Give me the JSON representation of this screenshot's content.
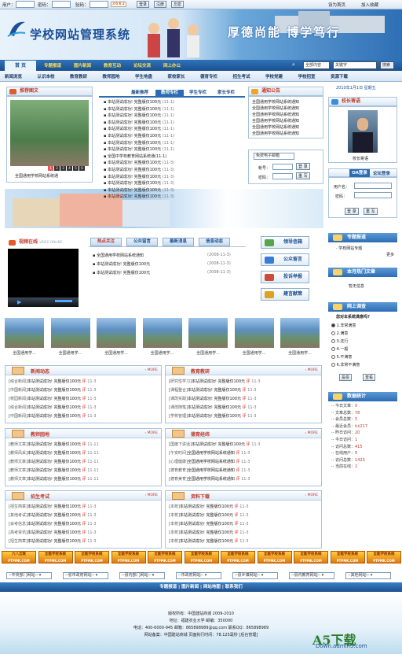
{
  "topbar": {
    "user_label": "用户：",
    "pass_label": "密码：",
    "code_label": "验码：",
    "code_val": "3 6 6 2",
    "login": "登录",
    "register": "注册",
    "forgot": "忘密",
    "homepage": "设为首页",
    "favorite": "加入收藏"
  },
  "header": {
    "site_title": "学校网站管理系统",
    "slogan": "厚德尚能  博学笃行"
  },
  "nav": {
    "home": "首 页",
    "items": [
      "专题报道",
      "图片新闻",
      "教育互动",
      "论坛交流",
      "网上办公"
    ],
    "search_scope": "全部内容",
    "search_value": "关键字",
    "search_btn": "搜索"
  },
  "subnav": [
    "新闻浏览",
    "认识本校",
    "教育教研",
    "教师园地",
    "学生地盘",
    "家校家长",
    "德育专栏",
    "招生考试",
    "学校党建",
    "学校招宣",
    "资源下载"
  ],
  "pic_news": {
    "title": "推荐图文",
    "caption": "全国通用学校网站系统通",
    "pages": [
      "1",
      "2",
      "3",
      "4",
      "5",
      "6"
    ]
  },
  "tabs": [
    "最新推荐",
    "教师专栏",
    "学生专栏",
    "家长专栏"
  ],
  "news_list": [
    {
      "t": "本站测试成功! 完整版仅100元",
      "d": "(11-1)"
    },
    {
      "t": "本站测试成功! 完整版仅100元",
      "d": "(11-1)"
    },
    {
      "t": "本站测试成功! 完整版仅100元",
      "d": "(11-1)"
    },
    {
      "t": "本站测试成功! 完整版仅100元",
      "d": "(11-1)"
    },
    {
      "t": "本站测试成功! 完整版仅100元",
      "d": "(11-1)"
    },
    {
      "t": "本站测试成功! 完整版仅100元",
      "d": "(11-1)"
    },
    {
      "t": "本站测试成功! 完整版仅100元",
      "d": "(11-1)"
    },
    {
      "t": "本站测试成功! 完整版仅100元",
      "d": "(11-1)"
    },
    {
      "t": "全国中学校教育网站系统通(11-1)",
      "d": ""
    },
    {
      "t": "本站测试成功! 完整版仅100元",
      "d": "(11-3)"
    },
    {
      "t": "本站测试成功! 完整版仅100元",
      "d": "(11-3)"
    },
    {
      "t": "本站测试成功! 完整版仅100元",
      "d": "(11-3)"
    },
    {
      "t": "本站测试成功! 完整版仅100元",
      "d": "(11-3)"
    },
    {
      "t": "本站测试成功! 完整版仅100元",
      "d": "(11-3)"
    },
    {
      "t": "本站测试成功! 完整版仅100元",
      "d": "(11-3)"
    }
  ],
  "notice": {
    "title": "通知公告",
    "items": [
      "全国通用学校网站系统通知",
      "全国通用学校网站系统通知",
      "全国通用学校网站系统通知",
      "全国通用学校网站系统通知",
      "全国通用学校网站系统通知",
      "全国通用学校网站系统通知"
    ]
  },
  "mail": {
    "select": "免费电子邮箱",
    "account": "帐号：",
    "password": "密码：",
    "login": "登 录",
    "reset": "重 写"
  },
  "calendar": {
    "date": "2010年1月1日 星期五"
  },
  "principal": {
    "title": "校长寄语",
    "caption": "校长寄语"
  },
  "oa": {
    "title": "OA登录",
    "forum": "论坛登录",
    "user": "用户名：",
    "pass": "密码：",
    "login": "登 录",
    "reset": "重 写"
  },
  "video": {
    "title": "视频在线",
    "subtitle": "VIDEO ONLINE"
  },
  "center_tabs": [
    "热点关注",
    "公众留言",
    "最新消息",
    "信息动态"
  ],
  "hot": [
    {
      "t": "全国通用学校网站系统通知",
      "d": "(2008-11-3)"
    },
    {
      "t": "本站测试成功! 完整版仅100元",
      "d": "(2008-11-3)"
    },
    {
      "t": "本站测试成功! 完整版仅100元",
      "d": "(2008-11-3)"
    }
  ],
  "action_buttons": [
    "领导信箱",
    "公众留言",
    "投诉举报",
    "建言献策"
  ],
  "topic": {
    "title": "专题报道",
    "item": "学校网站专题",
    "more": "更多"
  },
  "hot_article": {
    "title": "本月热门文章",
    "none": "暂无信息"
  },
  "poll": {
    "title": "网上调查",
    "question": "您对本系统满意吗?",
    "options": [
      "1.非常满意",
      "2.满意",
      "3.还行",
      "4.一般",
      "5.不满意",
      "6.非常不满意"
    ],
    "vote": "投票",
    "view": "查看"
  },
  "stats": {
    "title": "数据统计",
    "rows": [
      [
        "今日文章：",
        "0"
      ],
      [
        "文章总数：",
        "78"
      ],
      [
        "会员总数：",
        "5"
      ],
      [
        "最近会员：",
        "tui217"
      ],
      [
        "昨日访问：",
        "20"
      ],
      [
        "今日访问：",
        "1"
      ],
      [
        "访问总数：",
        "415"
      ],
      [
        "在线用户：",
        "6"
      ],
      [
        "访问总数：",
        "1423"
      ],
      [
        "当前在线：",
        "2"
      ]
    ]
  },
  "thumbs": [
    "全国通用学...",
    "全国通用学...",
    "全国通用学...",
    "全国通用学...",
    "全国通用学...",
    "全国通用学...",
    "全国通用学..."
  ],
  "sections": [
    {
      "title": "新闻动态",
      "items": [
        [
          "[综合新闻]",
          "本站测试成功! 完整版仅100元",
          "11-3"
        ],
        [
          "[中国新闻]",
          "本站测试成功! 完整版仅100元",
          "11-3"
        ],
        [
          "[校园新闻]",
          "本站测试成功! 完整版仅100元",
          "11-3"
        ],
        [
          "[综合新闻]",
          "本站测试成功! 完整版仅100元",
          "11-3"
        ],
        [
          "[中国新闻]",
          "本站测试成功! 完整版仅100元",
          "11-3"
        ]
      ]
    },
    {
      "title": "教育教研",
      "items": [
        [
          "[研究性学习]",
          "本站测试成功! 完整版仅100元",
          "11-3"
        ],
        [
          "[课程整合]",
          "本站测试成功! 完整版仅100元",
          "11-3"
        ],
        [
          "[课改实践]",
          "本站测试成功! 完整版仅100元",
          "11-3"
        ],
        [
          "[课改随笔]",
          "本站测试成功! 完整版仅100元",
          "11-3"
        ],
        [
          "[学校管理]",
          "本站测试成功! 完整版仅100元",
          "11-3"
        ]
      ]
    },
    {
      "title": "教师园地",
      "items": [
        [
          "[教师文章]",
          "本站测试成功! 完整版仅100元",
          "11-11"
        ],
        [
          "[教师风采]",
          "本站测试成功! 完整版仅100元",
          "11-11"
        ],
        [
          "[教师文章]",
          "本站测试成功! 完整版仅100元",
          "11-11"
        ],
        [
          "[教师文章]",
          "本站测试成功! 完整版仅100元",
          "11-11"
        ],
        [
          "[教师文章]",
          "本站测试成功! 完整版仅100元",
          "11-11"
        ]
      ]
    },
    {
      "title": "德育经纬",
      "items": [
        [
          "[国旗下讲话]",
          "本站测试成功! 完整版仅100元",
          "11-3"
        ],
        [
          "[午安时间]",
          "全国通用学校网站系统通知",
          "11-3"
        ],
        [
          "[心理健康]",
          "全国通用学校网站系统通知",
          "11-3"
        ],
        [
          "[德育教育]",
          "全国通用学校网站系统通知",
          "11-3"
        ],
        [
          "[德育美育]",
          "全国通用学校网站系统通知",
          "11-3"
        ]
      ]
    },
    {
      "title": "招生考试",
      "items": [
        [
          "[招生简章]",
          "本站测试成功! 完整版仅100元",
          "11-3"
        ],
        [
          "[其他考试]",
          "本站测试成功! 完整版仅100元",
          "11-3"
        ],
        [
          "[会考信息]",
          "本站测试成功! 完整版仅100元",
          "11-3"
        ],
        [
          "[高考资讯]",
          "本站测试成功! 完整版仅100元",
          "11-3"
        ],
        [
          "[招生简章]",
          "本站测试成功! 完整版仅100元",
          "11-3"
        ]
      ]
    },
    {
      "title": "资料下载",
      "items": [
        [
          "[本校]",
          "本站测试成功! 完整版仅100元",
          "11-3"
        ],
        [
          "[本校]",
          "本站测试成功! 完整版仅100元",
          "11-3"
        ],
        [
          "[本校]",
          "本站测试成功! 完整版仅100元",
          "11-3"
        ],
        [
          "[本校]",
          "本站测试成功! 完整版仅100元",
          "11-3"
        ],
        [
          "[本校]",
          "本站测试成功! 完整版仅100元",
          "11-3"
        ]
      ]
    }
  ],
  "section_more": "MORE",
  "ads": {
    "first": "六八互联",
    "label": "全能学校系统",
    "sub": "PTPMK.COM"
  },
  "selects": [
    "--中央部门网站--",
    "--省市政府网站--",
    "--县内部门网站--",
    "--市政府网站--",
    "--县乡镇网站--",
    "--县内教育网站--",
    "--其他网站--"
  ],
  "footer": {
    "links": "专题报道 | 图片新闻 | 网站地图 | 联系我们",
    "copyright": "版权所有：中国建站商城  2009-2010",
    "address": "地址：福建农业大学  邮编：350000",
    "contact": "电话：400-6000-945 邮箱：865898989@qq.com 联系QQ：865898989",
    "record": "网站备案：中国建站商城  页面执行时间：78.125毫秒  [后台管理]",
    "watermark": "A5下载",
    "watermark_url": "Down.admin5.com"
  }
}
